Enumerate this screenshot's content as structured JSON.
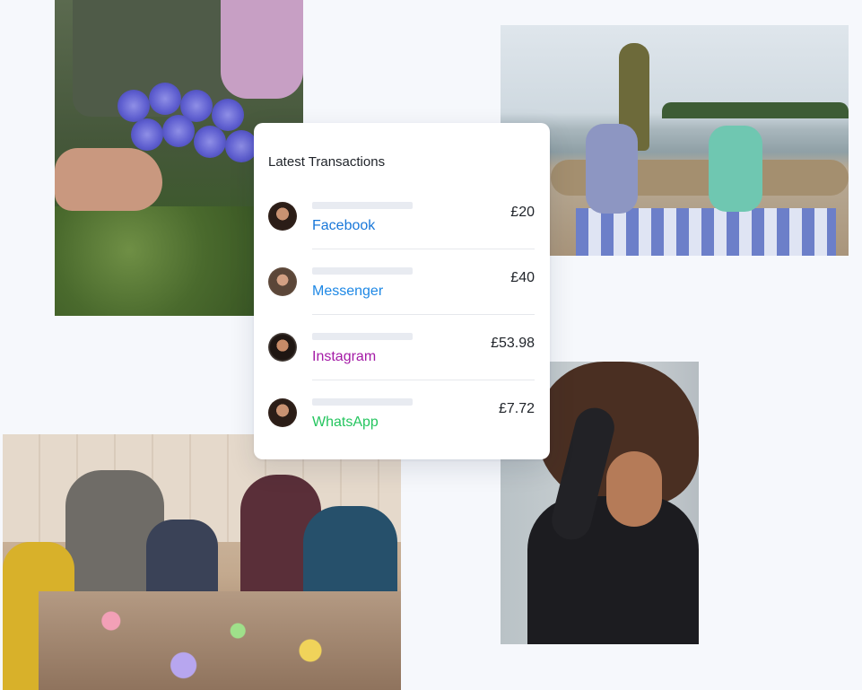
{
  "card": {
    "title": "Latest Transactions",
    "transactions": [
      {
        "name": "Facebook",
        "amount": "£20",
        "color": "#1877d9"
      },
      {
        "name": "Messenger",
        "amount": "£40",
        "color": "#1e88e5"
      },
      {
        "name": "Instagram",
        "amount": "£53.98",
        "color": "#a41ba6"
      },
      {
        "name": "WhatsApp",
        "amount": "£7.72",
        "color": "#25c55f"
      }
    ]
  },
  "photos": [
    "flowers-photo",
    "beach-photo",
    "party-photo",
    "portrait-photo"
  ],
  "colors": {
    "background": "#f6f8fc",
    "card": "#ffffff",
    "skeleton": "#e8ebf1"
  }
}
